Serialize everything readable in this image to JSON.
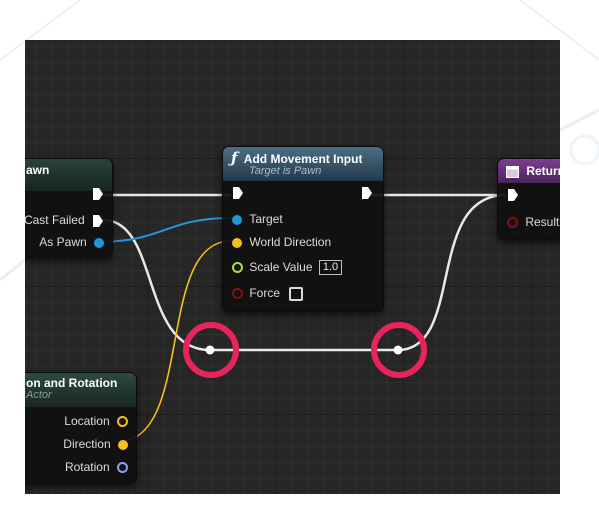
{
  "cast_node": {
    "title": "awn",
    "pins": {
      "cast_failed": "Cast Failed",
      "as_pawn": "As Pawn"
    }
  },
  "add_movement_node": {
    "icon": "function-icon",
    "title": "Add Movement Input",
    "subtitle": "Target is Pawn",
    "pins": {
      "target": "Target",
      "world_direction": "World Direction",
      "scale_value": "Scale Value",
      "scale_value_field": "1.0",
      "force": "Force"
    }
  },
  "return_node": {
    "title": "Return",
    "pins": {
      "result": "Result"
    }
  },
  "location_node": {
    "title": "on and Rotation",
    "subtitle": "Actor",
    "pins": {
      "location": "Location",
      "direction": "Direction",
      "rotation": "Rotation"
    }
  },
  "colors": {
    "graph_bg": "#262626",
    "exec_wire": "#ffffff",
    "object_pin": "#1f9ad8",
    "vector_pin": "#f4c01e",
    "float_pin": "#a6e04b",
    "bool_pin": "#8b0d0d",
    "rotator_pin": "#8f9ff2",
    "highlight": "#e8245a"
  }
}
